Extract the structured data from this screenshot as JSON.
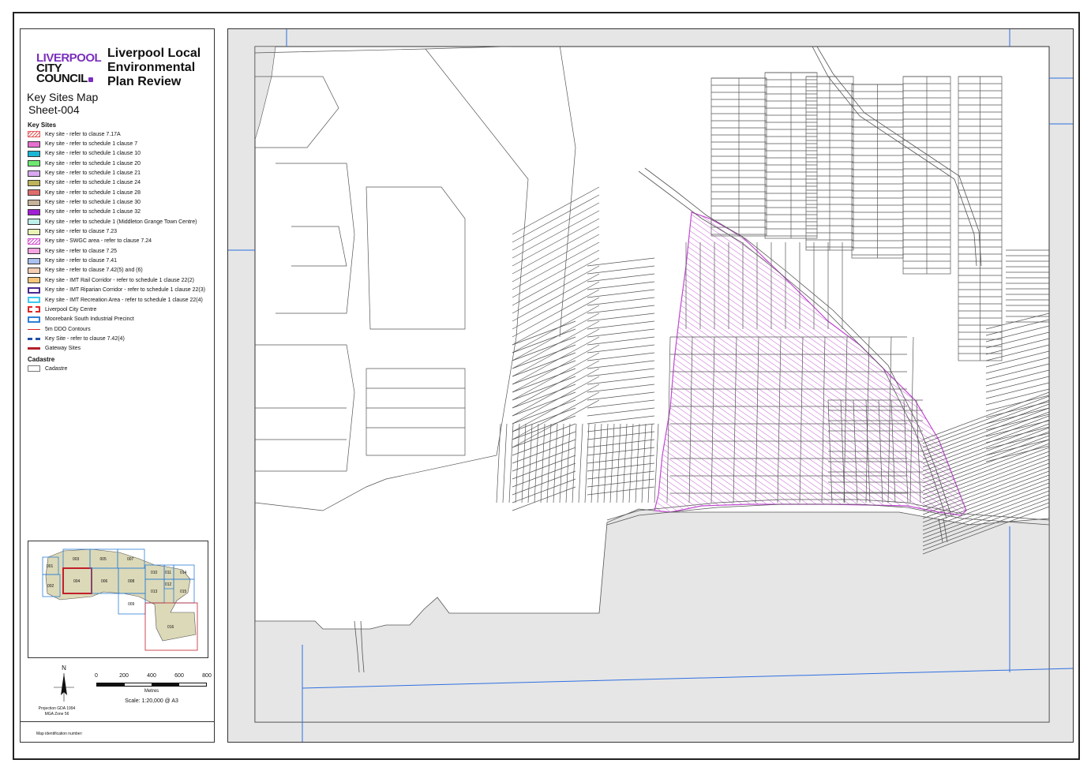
{
  "logo": {
    "line1": "LIVERPOOL",
    "line2": "CITY",
    "line3": "COUNCIL"
  },
  "plan_title": "Liverpool Local Environmental Plan Review",
  "map_title": "Key Sites Map",
  "sheet": "Sheet-004",
  "legend": {
    "key_sites_heading": "Key Sites",
    "items": [
      {
        "label": "Key site - refer to clause 7.17A",
        "style": "hatch",
        "color": "#e35b5b"
      },
      {
        "label": "Key site - refer to schedule 1 clause 7",
        "style": "fill",
        "color": "#e66fd1"
      },
      {
        "label": "Key site - refer to schedule 1 clause 10",
        "style": "fill",
        "color": "#19b6d6"
      },
      {
        "label": "Key site - refer to schedule 1 clause 20",
        "style": "fill",
        "color": "#6fe86f"
      },
      {
        "label": "Key site - refer to schedule 1 clause 21",
        "style": "fill",
        "color": "#d7a8ef"
      },
      {
        "label": "Key site - refer to schedule 1 clause 24",
        "style": "fill",
        "color": "#bcb35a"
      },
      {
        "label": "Key site - refer to schedule 1 clause 28",
        "style": "fill",
        "color": "#e06d6d"
      },
      {
        "label": "Key site - refer to schedule 1 clause 30",
        "style": "fill",
        "color": "#c7b29a"
      },
      {
        "label": "Key site - refer to schedule 1 clause 32",
        "style": "fill",
        "color": "#a31fd6"
      },
      {
        "label": "Key site - refer to schedule 1 (Middleton Grange Town Centre)",
        "style": "fill",
        "color": "#bdf0ea"
      },
      {
        "label": "Key site - refer to clause 7.23",
        "style": "fill",
        "color": "#e9f2b4"
      },
      {
        "label": "Key site - SWGC area - refer to clause 7.24",
        "style": "hatch",
        "color": "#d24fd0"
      },
      {
        "label": "Key site - refer to clause 7.25",
        "style": "fill",
        "color": "#f5a6e2"
      },
      {
        "label": "Key site - refer to clause 7.41",
        "style": "fill",
        "color": "#a9c2f0"
      },
      {
        "label": "Key site - refer to clause 7.42(5) and (6)",
        "style": "fill",
        "color": "#f3ceb2"
      },
      {
        "label": "Key site - IMT Rail Corridor - refer to schedule 1 clause 22(2)",
        "style": "fill",
        "color": "#f6c67a"
      },
      {
        "label": "Key site - IMT Riparian Corridor - refer to schedule 1 clause 22(3)",
        "style": "outline",
        "color": "#4b2a8f"
      },
      {
        "label": "Key site - IMT Recreation Area - refer to schedule 1 clause 22(4)",
        "style": "outline",
        "color": "#3fc9ef"
      },
      {
        "label": "Liverpool City Centre",
        "style": "dashed",
        "color": "#e02424"
      },
      {
        "label": "Moorebank South Industrial Precinct",
        "style": "outline",
        "color": "#2f7fd6"
      },
      {
        "label": "5m DDO Contours",
        "style": "line",
        "color": "#e02424"
      },
      {
        "label": "Key Site - refer to clause 7.42(4)",
        "style": "dashline",
        "color": "#1f4fa8"
      },
      {
        "label": "Gateway Sites",
        "style": "thickline",
        "color": "#b3202a"
      }
    ],
    "cadastre_heading": "Cadastre",
    "cadastre_item": {
      "label": "Cadastre",
      "style": "outline",
      "color": "#777777"
    }
  },
  "inset": {
    "sheets": [
      "001",
      "002",
      "003",
      "004",
      "005",
      "006",
      "007",
      "008",
      "009",
      "010",
      "011",
      "012",
      "013",
      "014",
      "015",
      "016"
    ],
    "current_sheet": "004",
    "colors": {
      "grid": "#2f7fd6",
      "lga": "#dcd9b8",
      "current": "#c0202a"
    }
  },
  "north_label": "N",
  "scale": {
    "ticks": [
      "0",
      "200",
      "400",
      "600",
      "800"
    ],
    "unit": "Metres",
    "text": "Scale: 1:20,000 @ A3"
  },
  "projection": {
    "line1": "Projection GDA 1994",
    "line2": "MGA Zone 56"
  },
  "map_id_label": "Map identification number:",
  "map_colors": {
    "hatch": "#c04bd0",
    "cadastre": "#555555",
    "outside": "#e6e6e6",
    "grid": "#2f6fe0"
  }
}
